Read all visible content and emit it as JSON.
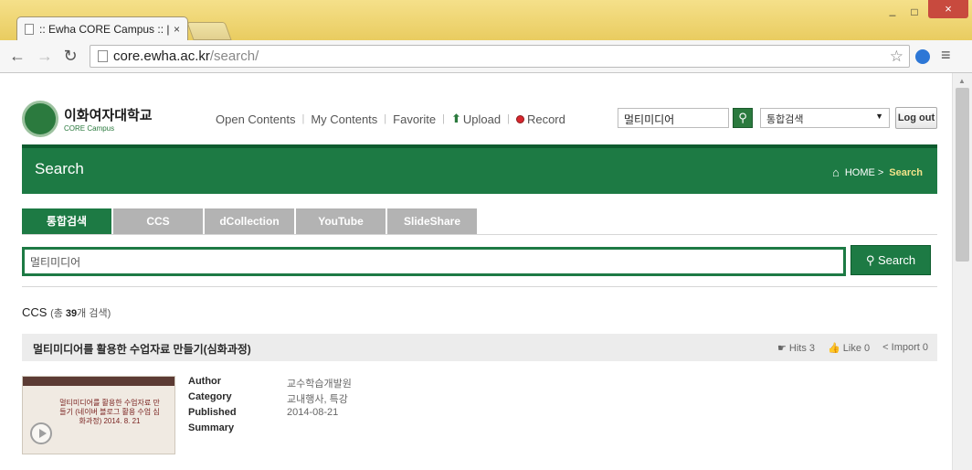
{
  "browser": {
    "tab_title": ":: Ewha CORE Campus :: |",
    "tab_close": "×",
    "url_host": "core.ewha.ac.kr",
    "url_path": "/search/",
    "window_min": "_",
    "window_max": "□",
    "window_close": "×"
  },
  "header": {
    "logo_ko": "이화여자대학교",
    "logo_en": "CORE Campus",
    "nav": [
      {
        "label": "Open Contents"
      },
      {
        "label": "My Contents"
      },
      {
        "label": "Favorite"
      },
      {
        "label": "Upload"
      },
      {
        "label": "Record"
      }
    ],
    "search_value": "멀티미디어",
    "select_value": "통합검색",
    "logout_label": "Log out"
  },
  "band": {
    "title": "Search",
    "crumb_home": "HOME",
    "crumb_sep": ">",
    "crumb_current": "Search"
  },
  "tabs": [
    {
      "label": "통합검색",
      "active": true
    },
    {
      "label": "CCS"
    },
    {
      "label": "dCollection"
    },
    {
      "label": "YouTube"
    },
    {
      "label": "SlideShare"
    }
  ],
  "main_search": {
    "value": "멀티미디어",
    "button_label": "Search"
  },
  "section": {
    "name": "CCS",
    "count_prefix": "(총 ",
    "count": "39",
    "count_suffix": "개 검색)"
  },
  "result": {
    "title": "멀티미디어를 활용한 수업자료 만들기(심화과정)",
    "hits": "Hits 3",
    "like": "Like 0",
    "import": "Import 0",
    "thumb_text": "멀티미디어를 활용한 수업자료 만들기 (네이버 블로그 활용 수업 심화과정) 2014. 8. 21",
    "fields": [
      {
        "label": "Author",
        "value": "교수학습개발원"
      },
      {
        "label": "Category",
        "value": "교내행사, 특강"
      },
      {
        "label": "Published",
        "value": "2014-08-21"
      },
      {
        "label": "Summary",
        "value": ""
      }
    ]
  }
}
